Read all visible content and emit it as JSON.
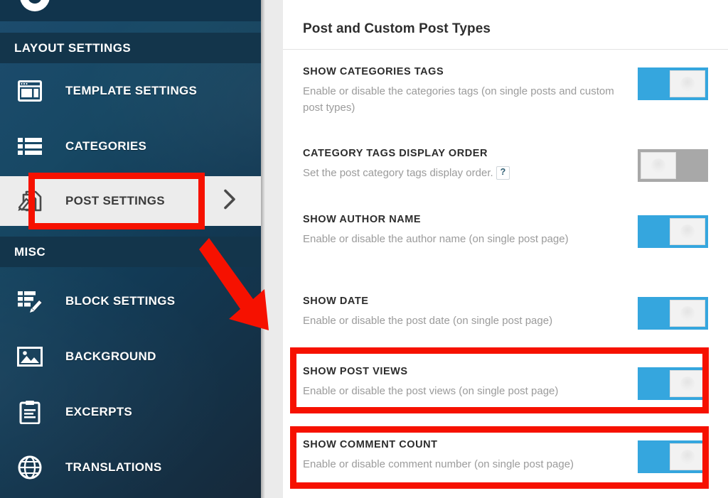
{
  "sidebar": {
    "logo_icon": "circle-logo-icon",
    "sections": [
      {
        "header": "LAYOUT SETTINGS",
        "items": [
          {
            "label": "TEMPLATE SETTINGS",
            "icon": "browser-window-icon",
            "active": false
          },
          {
            "label": "CATEGORIES",
            "icon": "list-icon",
            "active": false
          },
          {
            "label": "POST SETTINGS",
            "icon": "document-pen-icon",
            "active": true,
            "chevron": "chevron-right-icon"
          }
        ]
      },
      {
        "header": "MISC",
        "items": [
          {
            "label": "BLOCK SETTINGS",
            "icon": "block-edit-icon",
            "active": false
          },
          {
            "label": "BACKGROUND",
            "icon": "image-icon",
            "active": false
          },
          {
            "label": "EXCERPTS",
            "icon": "clipboard-icon",
            "active": false
          },
          {
            "label": "TRANSLATIONS",
            "icon": "globe-icon",
            "active": false
          }
        ]
      }
    ]
  },
  "panel": {
    "title": "Post and Custom Post Types",
    "settings": [
      {
        "title": "SHOW CATEGORIES TAGS",
        "desc": "Enable or disable the categories tags (on single posts and custom post types)",
        "toggle": "on",
        "help": false,
        "highlighted": false
      },
      {
        "title": "CATEGORY TAGS DISPLAY ORDER",
        "desc": "Set the post category tags display order.",
        "toggle": "off",
        "help": true,
        "help_label": "?",
        "highlighted": false
      },
      {
        "title": "SHOW AUTHOR NAME",
        "desc": "Enable or disable the author name (on single post page)",
        "toggle": "on",
        "help": false,
        "highlighted": false
      },
      {
        "title": "SHOW DATE",
        "desc": "Enable or disable the post date (on single post page)",
        "toggle": "on",
        "help": false,
        "highlighted": false
      },
      {
        "title": "SHOW POST VIEWS",
        "desc": "Enable or disable the post views (on single post page)",
        "toggle": "on",
        "help": false,
        "highlighted": true
      },
      {
        "title": "SHOW COMMENT COUNT",
        "desc": "Enable or disable comment number (on single post page)",
        "toggle": "on",
        "help": false,
        "highlighted": true
      }
    ]
  },
  "annotations": {
    "highlight_color": "#f61100",
    "arrow_icon": "red-arrow-down-right-icon",
    "boxes": [
      "post-settings-sidebar-item",
      "show-post-views-row",
      "show-comment-count-row"
    ]
  },
  "colors": {
    "sidebar_top": "#1d4c6e",
    "sidebar_bottom": "#16293a",
    "section_header_bg": "#13354b",
    "toggle_on": "#35a6de",
    "toggle_off": "#a8a8a8",
    "active_item_bg": "#ececec",
    "panel_bg": "#ffffff"
  }
}
